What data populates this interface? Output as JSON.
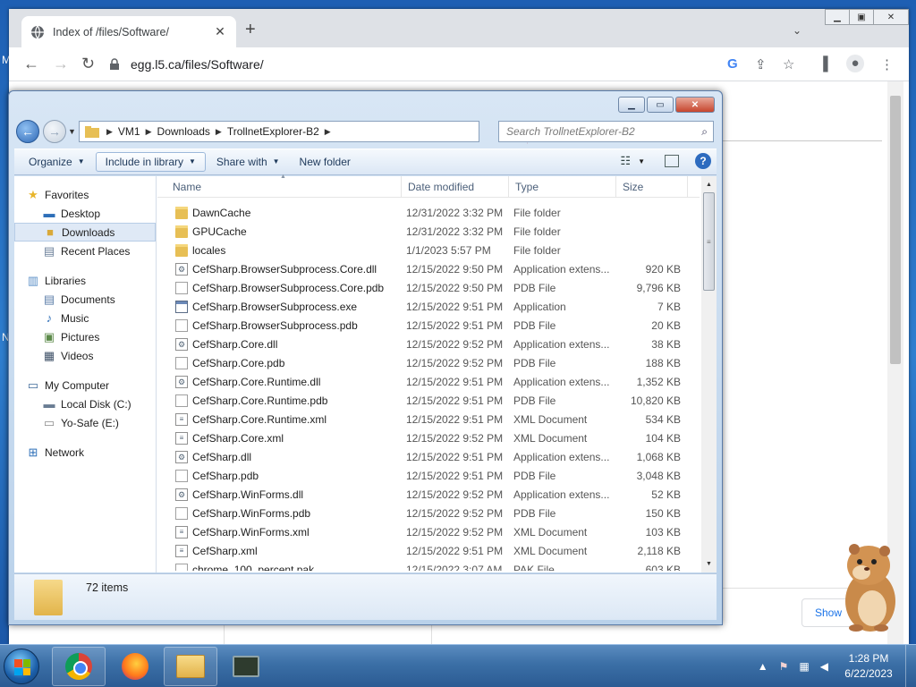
{
  "browser": {
    "tab_title": "Index of /files/Software/",
    "url": "egg.l5.ca/files/Software/",
    "page_button": "Show"
  },
  "explorer": {
    "breadcrumb": [
      "VM1",
      "Downloads",
      "TrollnetExplorer-B2"
    ],
    "search_placeholder": "Search TrollnetExplorer-B2",
    "commands": {
      "organize": "Organize",
      "include_library": "Include in library",
      "share_with": "Share with",
      "new_folder": "New folder"
    },
    "nav": {
      "favorites": "Favorites",
      "desktop": "Desktop",
      "downloads": "Downloads",
      "recent_places": "Recent Places",
      "libraries": "Libraries",
      "documents": "Documents",
      "music": "Music",
      "pictures": "Pictures",
      "videos": "Videos",
      "my_computer": "My Computer",
      "local_disk": "Local Disk (C:)",
      "yo_safe": "Yo-Safe (E:)",
      "network": "Network"
    },
    "columns": {
      "name": "Name",
      "date_modified": "Date modified",
      "type": "Type",
      "size": "Size"
    },
    "files": [
      {
        "name": "DawnCache",
        "date": "12/31/2022 3:32 PM",
        "type": "File folder",
        "size": "",
        "icon": "folder-icon"
      },
      {
        "name": "GPUCache",
        "date": "12/31/2022 3:32 PM",
        "type": "File folder",
        "size": "",
        "icon": "folder-icon"
      },
      {
        "name": "locales",
        "date": "1/1/2023 5:57 PM",
        "type": "File folder",
        "size": "",
        "icon": "folder-icon"
      },
      {
        "name": "CefSharp.BrowserSubprocess.Core.dll",
        "date": "12/15/2022 9:50 PM",
        "type": "Application extens...",
        "size": "920 KB",
        "icon": "dll-icon"
      },
      {
        "name": "CefSharp.BrowserSubprocess.Core.pdb",
        "date": "12/15/2022 9:50 PM",
        "type": "PDB File",
        "size": "9,796 KB",
        "icon": "file-icon"
      },
      {
        "name": "CefSharp.BrowserSubprocess.exe",
        "date": "12/15/2022 9:51 PM",
        "type": "Application",
        "size": "7 KB",
        "icon": "exe-icon"
      },
      {
        "name": "CefSharp.BrowserSubprocess.pdb",
        "date": "12/15/2022 9:51 PM",
        "type": "PDB File",
        "size": "20 KB",
        "icon": "file-icon"
      },
      {
        "name": "CefSharp.Core.dll",
        "date": "12/15/2022 9:52 PM",
        "type": "Application extens...",
        "size": "38 KB",
        "icon": "dll-icon"
      },
      {
        "name": "CefSharp.Core.pdb",
        "date": "12/15/2022 9:52 PM",
        "type": "PDB File",
        "size": "188 KB",
        "icon": "file-icon"
      },
      {
        "name": "CefSharp.Core.Runtime.dll",
        "date": "12/15/2022 9:51 PM",
        "type": "Application extens...",
        "size": "1,352 KB",
        "icon": "dll-icon"
      },
      {
        "name": "CefSharp.Core.Runtime.pdb",
        "date": "12/15/2022 9:51 PM",
        "type": "PDB File",
        "size": "10,820 KB",
        "icon": "file-icon"
      },
      {
        "name": "CefSharp.Core.Runtime.xml",
        "date": "12/15/2022 9:51 PM",
        "type": "XML Document",
        "size": "534 KB",
        "icon": "xml-icon"
      },
      {
        "name": "CefSharp.Core.xml",
        "date": "12/15/2022 9:52 PM",
        "type": "XML Document",
        "size": "104 KB",
        "icon": "xml-icon"
      },
      {
        "name": "CefSharp.dll",
        "date": "12/15/2022 9:51 PM",
        "type": "Application extens...",
        "size": "1,068 KB",
        "icon": "dll-icon"
      },
      {
        "name": "CefSharp.pdb",
        "date": "12/15/2022 9:51 PM",
        "type": "PDB File",
        "size": "3,048 KB",
        "icon": "file-icon"
      },
      {
        "name": "CefSharp.WinForms.dll",
        "date": "12/15/2022 9:52 PM",
        "type": "Application extens...",
        "size": "52 KB",
        "icon": "dll-icon"
      },
      {
        "name": "CefSharp.WinForms.pdb",
        "date": "12/15/2022 9:52 PM",
        "type": "PDB File",
        "size": "150 KB",
        "icon": "file-icon"
      },
      {
        "name": "CefSharp.WinForms.xml",
        "date": "12/15/2022 9:52 PM",
        "type": "XML Document",
        "size": "103 KB",
        "icon": "xml-icon"
      },
      {
        "name": "CefSharp.xml",
        "date": "12/15/2022 9:51 PM",
        "type": "XML Document",
        "size": "2,118 KB",
        "icon": "xml-icon"
      },
      {
        "name": "chrome_100_percent.pak",
        "date": "12/15/2022 3:07 AM",
        "type": "PAK File",
        "size": "603 KB",
        "icon": "file-icon"
      }
    ],
    "item_count": "72 items"
  },
  "taskbar": {
    "time": "1:28 PM",
    "date": "6/22/2023"
  }
}
